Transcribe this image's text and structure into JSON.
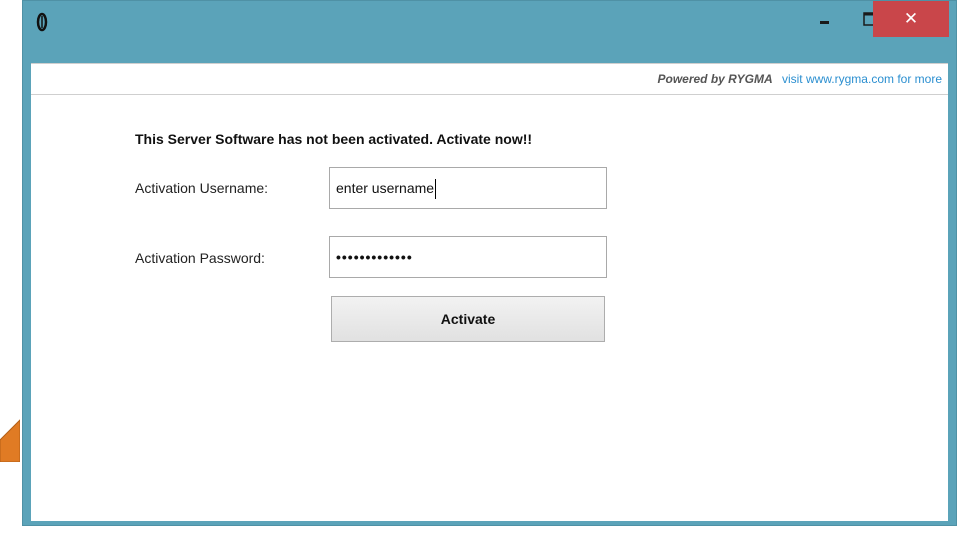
{
  "window": {
    "close_glyph": "✕",
    "titlebar_color": "#5ba3b9",
    "close_color": "#c9464a"
  },
  "header": {
    "powered_by": "Powered by RYGMA",
    "visit_link": "visit www.rygma.com for more"
  },
  "form": {
    "notice": "This Server Software has not been activated. Activate now!!",
    "username_label": "Activation Username:",
    "username_value": "enter username",
    "password_label": "Activation Password:",
    "password_value": "•••••••••••••",
    "activate_label": "Activate"
  },
  "icons": {
    "app": "app-icon",
    "minimize": "minimize-icon",
    "maximize": "maximize-icon",
    "close": "close-icon"
  }
}
